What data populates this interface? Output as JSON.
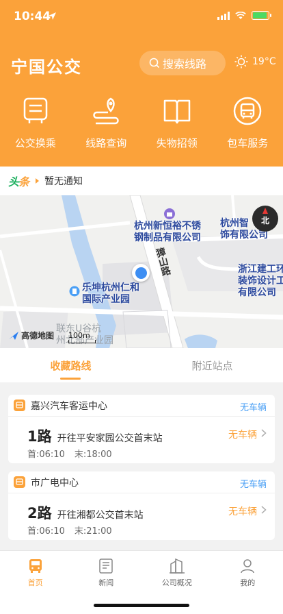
{
  "status_bar": {
    "time": "10:44"
  },
  "header": {
    "title": "宁国公交",
    "search_placeholder": "搜索线路",
    "weather_temp": "19°C"
  },
  "quick_menu": [
    {
      "label": "公交换乘",
      "icon": "bus-transfer-icon"
    },
    {
      "label": "线路查询",
      "icon": "route-query-icon"
    },
    {
      "label": "失物招领",
      "icon": "lost-found-icon"
    },
    {
      "label": "包车服务",
      "icon": "charter-bus-icon"
    }
  ],
  "notice": {
    "logo_a": "头",
    "logo_b": "条",
    "text": "暂无通知"
  },
  "map": {
    "poi1": "杭州新恒裕不锈\n钢制品有限公司",
    "poi2": "杭州智\n饰有限公司",
    "poi3": "浙江建工环\n装饰设计工\n有限公司",
    "poi4": "乐坤杭州仁和\n国际产业园",
    "poi5": "联东U谷杭\n州北部产业园",
    "road": "獐山路",
    "compass": "北",
    "logo": "高德地图",
    "scale": "100m"
  },
  "tabs": {
    "favorites": "收藏路线",
    "nearby": "附近站点"
  },
  "routes": [
    {
      "station": "嘉兴汽车客运中心",
      "head_status": "无车辆",
      "name": "1路",
      "destination": "开往平安家园公交首末站",
      "status": "无车辆",
      "first": "首:06:10",
      "last": "末:18:00"
    },
    {
      "station": "市广电中心",
      "head_status": "无车辆",
      "name": "2路",
      "destination": "开往湘都公交首末站",
      "status": "无车辆",
      "first": "首:06:10",
      "last": "末:21:00"
    }
  ],
  "nav": [
    {
      "label": "首页",
      "icon": "bus-home-icon"
    },
    {
      "label": "新闻",
      "icon": "news-icon"
    },
    {
      "label": "公司概况",
      "icon": "company-icon"
    },
    {
      "label": "我的",
      "icon": "profile-icon"
    }
  ],
  "colors": {
    "brand": "#fba23a",
    "link": "#4a9ff5",
    "location": "#3d8ef3"
  }
}
